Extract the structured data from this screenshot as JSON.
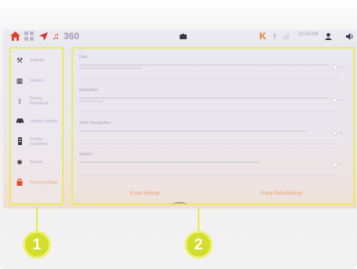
{
  "topbar": {
    "icons": [
      "home-icon",
      "grid-icon",
      "navigation-icon",
      "music-icon",
      "view-360-icon",
      "camera-icon",
      "mic-icon",
      "signal-icon",
      "user-icon",
      "volume-icon"
    ],
    "view360_text": "360",
    "time": "10:53 AM"
  },
  "sidebar": {
    "items": [
      {
        "label": "Settings",
        "icon": "settings-icon"
      },
      {
        "label": "General",
        "icon": "grid-icon"
      },
      {
        "label": "Driving Assistance",
        "icon": "driving-assist-icon"
      },
      {
        "label": "Vehicle Settings",
        "icon": "car-icon"
      },
      {
        "label": "Vehicle Conditions",
        "icon": "vehicle-conditions-icon"
      },
      {
        "label": "System",
        "icon": "gear-icon"
      },
      {
        "label": "Privacy Settings",
        "icon": "lock-icon"
      }
    ],
    "active_index": 6
  },
  "main": {
    "rows": [
      {
        "title": "Data",
        "toggle": "Off"
      },
      {
        "title": "Navigation",
        "toggle": "Off"
      },
      {
        "title": "Voice Recognition",
        "toggle": "Off"
      },
      {
        "title": "Speech",
        "toggle": "Off"
      }
    ],
    "actions": {
      "left": "Erase Settings",
      "right": "Erase Data/Settings"
    }
  },
  "callouts": {
    "one": "1",
    "two": "2"
  },
  "colors": {
    "accent_red": "#e0412e",
    "callout_yellow": "#d4dd2a",
    "highlight_border": "#e6ec5a",
    "active_text": "#f0a36a"
  }
}
